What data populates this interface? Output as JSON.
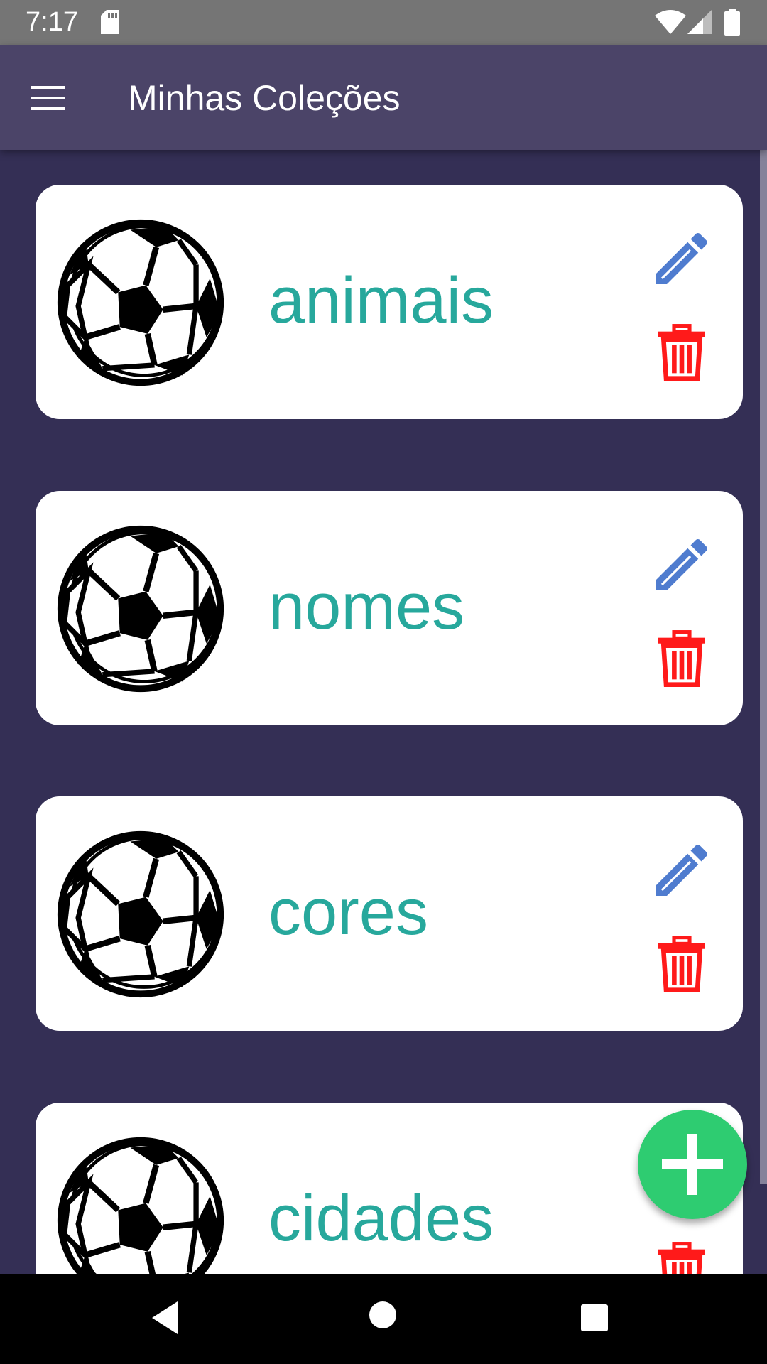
{
  "status_bar": {
    "time": "7:17",
    "icons": [
      "sd-card-icon",
      "wifi-icon",
      "signal-icon",
      "battery-icon"
    ]
  },
  "app_bar": {
    "title": "Minhas Coleções",
    "menu_icon": "hamburger-menu-icon"
  },
  "collections": [
    {
      "label": "animais",
      "icon": "soccer-ball-icon"
    },
    {
      "label": "nomes",
      "icon": "soccer-ball-icon"
    },
    {
      "label": "cores",
      "icon": "soccer-ball-icon"
    },
    {
      "label": "cidades",
      "icon": "soccer-ball-icon"
    }
  ],
  "actions": {
    "edit_icon": "pencil-icon",
    "delete_icon": "trash-icon",
    "add_icon": "plus-icon"
  },
  "colors": {
    "background": "#342f55",
    "app_bar": "#4b4468",
    "label": "#27a89c",
    "edit": "#4f7ccf",
    "delete": "#ff1a1a",
    "fab": "#2ecc71"
  },
  "nav_bar": {
    "icons": [
      "back-icon",
      "home-icon",
      "recents-icon"
    ]
  }
}
